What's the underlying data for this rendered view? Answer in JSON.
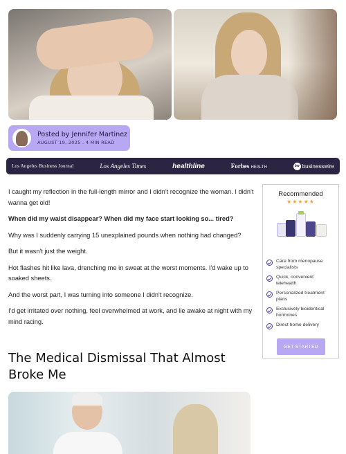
{
  "author": {
    "posted": "Posted by Jennifer Martinez",
    "date": "AUGUST 19, 2025 . 4 MIN READ"
  },
  "logos": {
    "items": [
      "Los Angeles Business Journal",
      "Los Angeles Times",
      "healthline",
      "Forbes",
      "HEALTH",
      "businesswire"
    ],
    "bw_mark": "bw"
  },
  "article": {
    "paragraphs": [
      "I caught my reflection in the full-length mirror and I didn't recognize the woman. I didn't wanna get old!",
      "When did my waist disappear? When did my face start looking so... tired?",
      "Why was I suddenly carrying 15 unexplained pounds when nothing had changed?",
      "But it wasn't just the weight.",
      "Hot flashes hit like lava, drenching me in sweat at the worst moments. I'd wake up to soaked sheets.",
      "And the worst part, I was turning into someone I didn't recognize.",
      "I'd get irritated over nothing, feel overwhelmed at work, and lie awake at night with my mind racing."
    ],
    "heading": "The Medical Dismissal That Almost Broke Me"
  },
  "sidebar": {
    "title": "Recommended",
    "stars": "★★★★★",
    "rating": 5,
    "features": [
      "Care from menopause specialists",
      "Quick, convenient telehealth",
      "Personalized treatment plans",
      "Exclusively bioidentical hormones",
      "Direct home delivery"
    ],
    "cta_label": "GET STARTED"
  },
  "colors": {
    "accent": "#b8a8f3",
    "logo_bar": "#2b2543",
    "check": "#4a3fae",
    "stars": "#e8a63a"
  }
}
